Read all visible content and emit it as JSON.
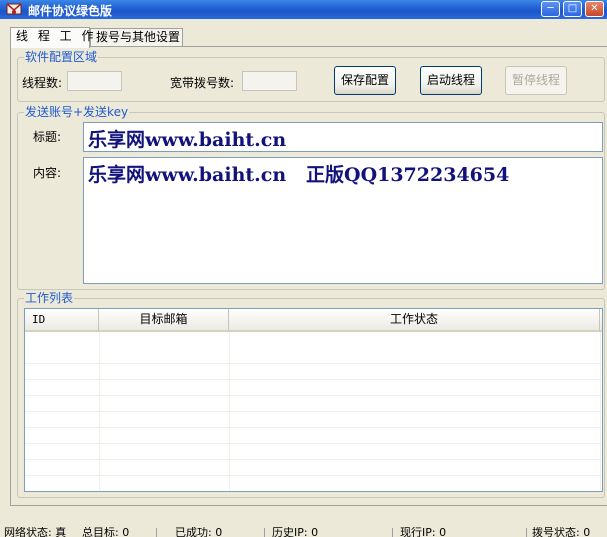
{
  "window": {
    "title": "邮件协议绿色版"
  },
  "tabs": [
    {
      "label": "线 程 工 作"
    },
    {
      "label": "拨号与其他设置"
    }
  ],
  "software_config": {
    "legend": "软件配置区域",
    "thread_count_label": "线程数:",
    "thread_count_value": "",
    "dial_count_label": "宽带拨号数:",
    "dial_count_value": "",
    "save_button": "保存配置",
    "start_button": "启动线程",
    "pause_button": "暂停线程"
  },
  "send_account": {
    "legend": "发送账号+发送key",
    "subject_label": "标题:",
    "subject_value": "乐享网www.baiht.cn",
    "content_label": "内容:",
    "content_value": "乐享网www.baiht.cn   正版QQ1372234654"
  },
  "work_list": {
    "legend": "工作列表",
    "columns": [
      "ID",
      "目标邮箱",
      "工作状态"
    ]
  },
  "statusbar": {
    "items": [
      "网络状态: 真",
      "总目标: 0",
      "已成功: 0",
      "历史IP: 0",
      "现行IP: 0",
      "拨号状态: 0"
    ]
  },
  "colors": {
    "accent": "#1f5ad0",
    "text_input": "#12127a"
  }
}
